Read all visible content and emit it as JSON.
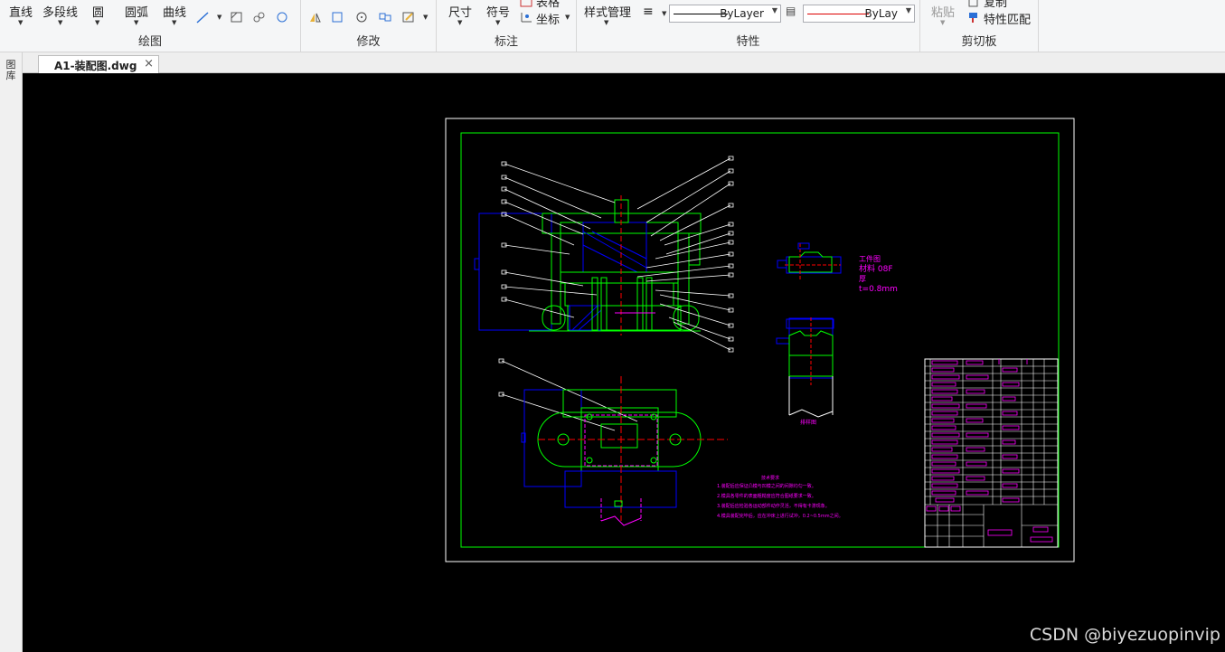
{
  "ribbon": {
    "draw": {
      "label": "绘图",
      "line": "直线",
      "polyline": "多段线",
      "circle": "圆",
      "arc": "圆弧",
      "curve": "曲线"
    },
    "modify": {
      "label": "修改"
    },
    "annotate": {
      "label": "标注",
      "dimension": "尺寸",
      "symbol": "符号",
      "table": "表格",
      "coordinate": "坐标"
    },
    "properties": {
      "label": "特性",
      "style_manager": "样式管理",
      "linetype_value": "ByLayer",
      "color_value": "ByLay"
    },
    "clipboard": {
      "label": "剪切板",
      "paste": "粘贴",
      "copy": "复制",
      "match_properties": "特性匹配"
    }
  },
  "tabs": [
    {
      "name": "A1-装配图.dwg",
      "close": "×"
    }
  ],
  "left_palette": {
    "label": "图库"
  },
  "drawing": {
    "material_note": {
      "line1": "工件图",
      "line2": "材料 08F",
      "line3": "厚",
      "line4": "t=0.8mm"
    },
    "layout_caption": "排样图",
    "tech_req": {
      "title": "技术要求",
      "items": [
        "1.装配后应保证凸模与凹模之间的间隙均匀一致。",
        "2.模具各零件的表面粗糙度应符合图纸要求一致。",
        "3.装配后应检验各运动部件动作灵活，不得有卡滞现象。",
        "4.模具装配完毕后，应在冲床上进行试冲，0.2~0.5mm之间。"
      ]
    }
  },
  "watermark": "CSDN @biyezuopinvip",
  "colors": {
    "canvas": "#000000",
    "green": "#00ff00",
    "blue": "#0000ff",
    "red": "#ff0000",
    "magenta": "#ff00ff",
    "white": "#ffffff"
  }
}
